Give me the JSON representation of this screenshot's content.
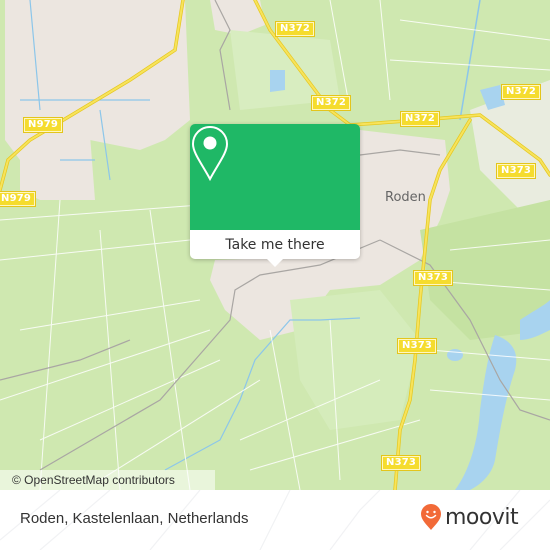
{
  "map": {
    "place_label": "Roden",
    "road_labels": [
      {
        "id": "n372-a",
        "text": "N372"
      },
      {
        "id": "n372-b",
        "text": "N372"
      },
      {
        "id": "n372-c",
        "text": "N372"
      },
      {
        "id": "n979-a",
        "text": "N979"
      },
      {
        "id": "n979-b",
        "text": "N979"
      },
      {
        "id": "n373-a",
        "text": "N373"
      },
      {
        "id": "n373-b",
        "text": "N373"
      },
      {
        "id": "n373-c",
        "text": "N373"
      },
      {
        "id": "n373-d",
        "text": "N373"
      }
    ],
    "attribution": "© OpenStreetMap contributors",
    "colors": {
      "land": "#cfe8b0",
      "urban": "#efe9e4",
      "water": "#a8d3ef",
      "road": "#f5dc2e",
      "accent": "#1fb866"
    }
  },
  "popup": {
    "icon": "map-pin-icon",
    "button_label": "Take me there"
  },
  "footer": {
    "address": "Roden, Kastelenlaan, Netherlands",
    "logo_text": "moovit",
    "logo_icon": "moovit-smile-pin-icon",
    "logo_color": "#f26a38"
  }
}
